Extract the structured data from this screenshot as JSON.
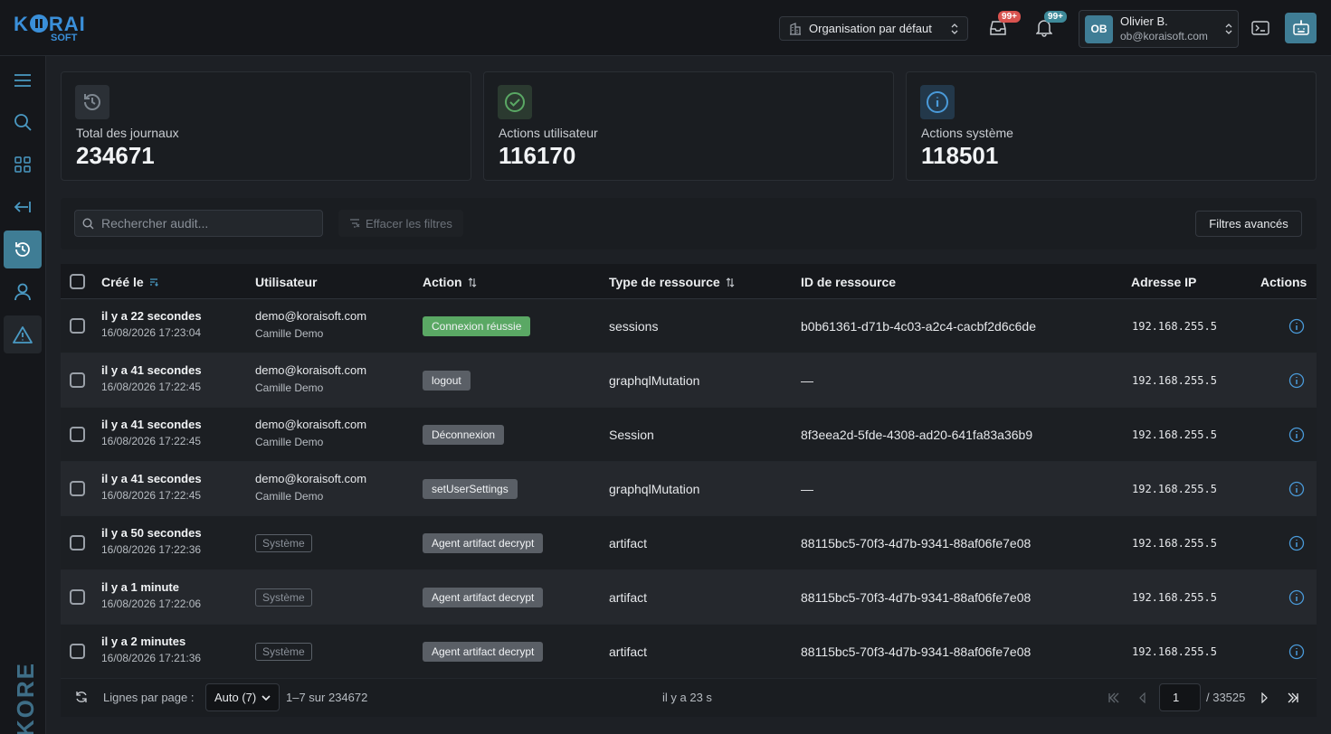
{
  "brand": {
    "name_part1": "K",
    "name_part2": "RAI",
    "sub": "SOFT",
    "vertical_name": "KORE"
  },
  "topbar": {
    "org_label": "Organisation par défaut",
    "inbox_badge": "99+",
    "notif_badge": "99+",
    "user": {
      "initials": "OB",
      "name": "Olivier B.",
      "email": "ob@koraisoft.com"
    }
  },
  "stats": [
    {
      "title": "Total des journaux",
      "value": "234671",
      "icon": "history-icon"
    },
    {
      "title": "Actions utilisateur",
      "value": "116170",
      "icon": "check-circle-icon"
    },
    {
      "title": "Actions système",
      "value": "118501",
      "icon": "info-icon"
    }
  ],
  "filters": {
    "search_placeholder": "Rechercher audit...",
    "clear_label": "Effacer les filtres",
    "advanced_label": "Filtres avancés"
  },
  "table": {
    "columns": {
      "created": "Créé le",
      "user": "Utilisateur",
      "action": "Action",
      "resource_type": "Type de ressource",
      "resource_id": "ID de ressource",
      "ip": "Adresse IP",
      "actions": "Actions"
    },
    "rows": [
      {
        "rel": "il y a 22 secondes",
        "date": "16/08/2026 17:23:04",
        "email": "demo@koraisoft.com",
        "name": "Camille Demo",
        "system": "",
        "action": "Connexion réussie",
        "action_color": "green",
        "type": "sessions",
        "rid": "b0b61361-d71b-4c03-a2c4-cacbf2d6c6de",
        "ip": "192.168.255.5"
      },
      {
        "rel": "il y a 41 secondes",
        "date": "16/08/2026 17:22:45",
        "email": "demo@koraisoft.com",
        "name": "Camille Demo",
        "system": "",
        "action": "logout",
        "action_color": "gray",
        "type": "graphqlMutation",
        "rid": "—",
        "ip": "192.168.255.5"
      },
      {
        "rel": "il y a 41 secondes",
        "date": "16/08/2026 17:22:45",
        "email": "demo@koraisoft.com",
        "name": "Camille Demo",
        "system": "",
        "action": "Déconnexion",
        "action_color": "gray",
        "type": "Session",
        "rid": "8f3eea2d-5fde-4308-ad20-641fa83a36b9",
        "ip": "192.168.255.5"
      },
      {
        "rel": "il y a 41 secondes",
        "date": "16/08/2026 17:22:45",
        "email": "demo@koraisoft.com",
        "name": "Camille Demo",
        "system": "",
        "action": "setUserSettings",
        "action_color": "gray",
        "type": "graphqlMutation",
        "rid": "—",
        "ip": "192.168.255.5"
      },
      {
        "rel": "il y a 50 secondes",
        "date": "16/08/2026 17:22:36",
        "email": "",
        "name": "",
        "system": "Système",
        "action": "Agent artifact decrypt",
        "action_color": "gray",
        "type": "artifact",
        "rid": "88115bc5-70f3-4d7b-9341-88af06fe7e08",
        "ip": "192.168.255.5"
      },
      {
        "rel": "il y a 1 minute",
        "date": "16/08/2026 17:22:06",
        "email": "",
        "name": "",
        "system": "Système",
        "action": "Agent artifact decrypt",
        "action_color": "gray",
        "type": "artifact",
        "rid": "88115bc5-70f3-4d7b-9341-88af06fe7e08",
        "ip": "192.168.255.5"
      },
      {
        "rel": "il y a 2 minutes",
        "date": "16/08/2026 17:21:36",
        "email": "",
        "name": "",
        "system": "Système",
        "action": "Agent artifact decrypt",
        "action_color": "gray",
        "type": "artifact",
        "rid": "88115bc5-70f3-4d7b-9341-88af06fe7e08",
        "ip": "192.168.255.5"
      }
    ]
  },
  "footer": {
    "rows_label": "Lignes par page :",
    "rows_value": "Auto (7)",
    "range": "1–7 sur 234672",
    "updated": "il y a 23 s",
    "page": "1",
    "total_pages": "/ 33525"
  },
  "colors": {
    "accent": "#3f7d95",
    "brand": "#3a8fd9",
    "success": "#5aa864",
    "danger": "#d9534f"
  }
}
